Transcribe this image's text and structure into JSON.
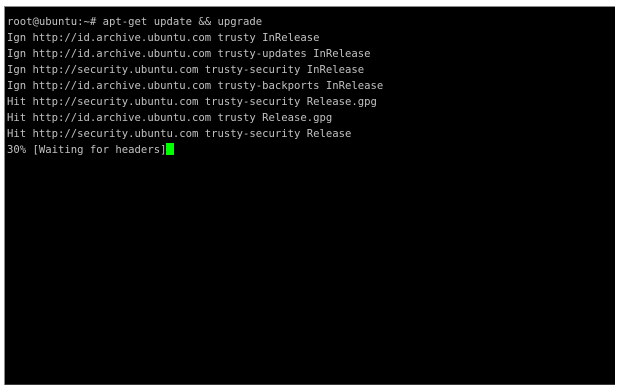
{
  "terminal": {
    "lines": [
      "root@ubuntu:~# apt-get update && upgrade",
      "Ign http://id.archive.ubuntu.com trusty InRelease",
      "Ign http://id.archive.ubuntu.com trusty-updates InRelease",
      "Ign http://security.ubuntu.com trusty-security InRelease",
      "Ign http://id.archive.ubuntu.com trusty-backports InRelease",
      "Hit http://security.ubuntu.com trusty-security Release.gpg",
      "Hit http://id.archive.ubuntu.com trusty Release.gpg",
      "Hit http://security.ubuntu.com trusty-security Release"
    ],
    "progress_line": "30% [Waiting for headers]",
    "colors": {
      "background": "#000000",
      "text": "#c0c0c0",
      "cursor": "#00ff00"
    }
  }
}
